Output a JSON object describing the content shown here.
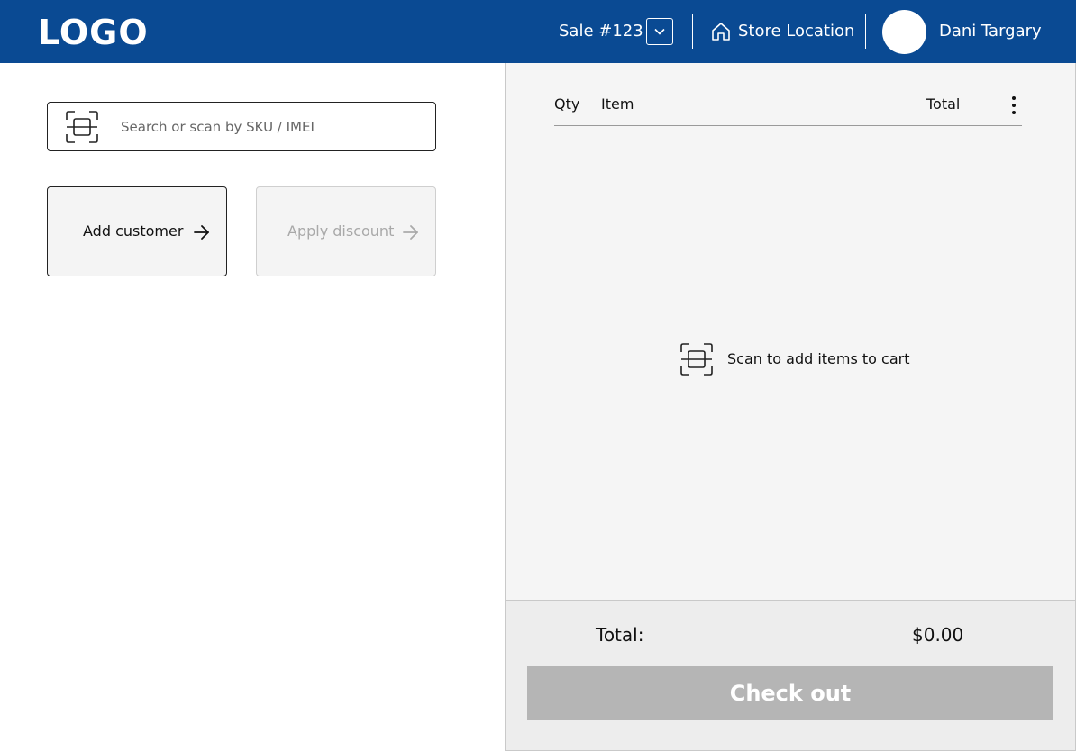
{
  "header": {
    "logo": "LOGO",
    "sale_label": "Sale #123",
    "store_label": "Store Location",
    "user_name": "Dani Targary"
  },
  "search": {
    "placeholder": "Search or scan by SKU / IMEI"
  },
  "actions": {
    "add_customer": "Add customer",
    "apply_discount": "Apply discount"
  },
  "cart": {
    "columns": {
      "qty": "Qty",
      "item": "Item",
      "total": "Total"
    },
    "empty_message": "Scan to add items to cart"
  },
  "summary": {
    "total_label": "Total:",
    "total_value": "$0.00",
    "checkout_label": "Check out"
  },
  "colors": {
    "header_bg": "#0a4a93",
    "checkout_disabled": "#b5b5b5",
    "cart_bg": "#f5f5f5"
  },
  "icons": {
    "dropdown": "chevron-down-icon",
    "store": "home-icon",
    "scan": "barcode-scan-icon",
    "arrow": "arrow-right-icon",
    "menu": "more-vertical-icon"
  }
}
